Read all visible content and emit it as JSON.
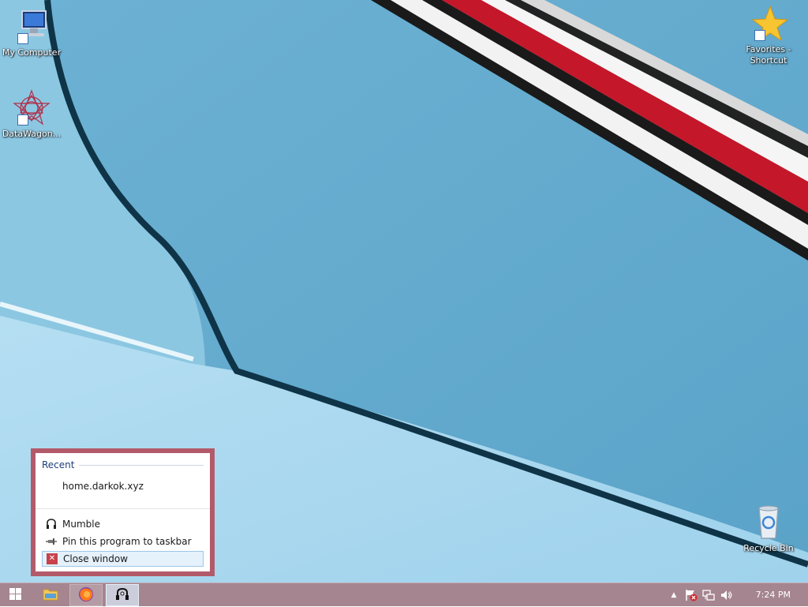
{
  "desktop": {
    "icons": [
      {
        "label": "My Computer",
        "icon": "computer-icon"
      },
      {
        "label": "DataWagon...",
        "icon": "datawagon-icon"
      },
      {
        "label": "Favorites -\nShortcut",
        "icon": "star-icon"
      },
      {
        "label": "Recycle Bin",
        "icon": "recycle-bin-icon"
      }
    ]
  },
  "jumplist": {
    "recent_header": "Recent",
    "recent_items": [
      "home.darkok.xyz"
    ],
    "tasks": [
      {
        "label": "Mumble",
        "icon": "mumble-icon"
      },
      {
        "label": "Pin this program to taskbar",
        "icon": "pin-icon"
      },
      {
        "label": "Close window",
        "icon": "close-icon"
      }
    ]
  },
  "taskbar": {
    "items": [
      {
        "icon": "windows-start-icon"
      },
      {
        "icon": "file-explorer-icon"
      },
      {
        "icon": "firefox-icon"
      },
      {
        "icon": "mumble-icon"
      }
    ],
    "tray_icons": [
      "show-hidden-icons-chevron",
      "action-center-flag-icon",
      "network-icon",
      "volume-icon"
    ],
    "clock": "7:24 PM"
  },
  "colors": {
    "taskbar": "#a5858f",
    "jumplist_border": "#b35a6a",
    "accent_header": "#1e3f7a"
  }
}
